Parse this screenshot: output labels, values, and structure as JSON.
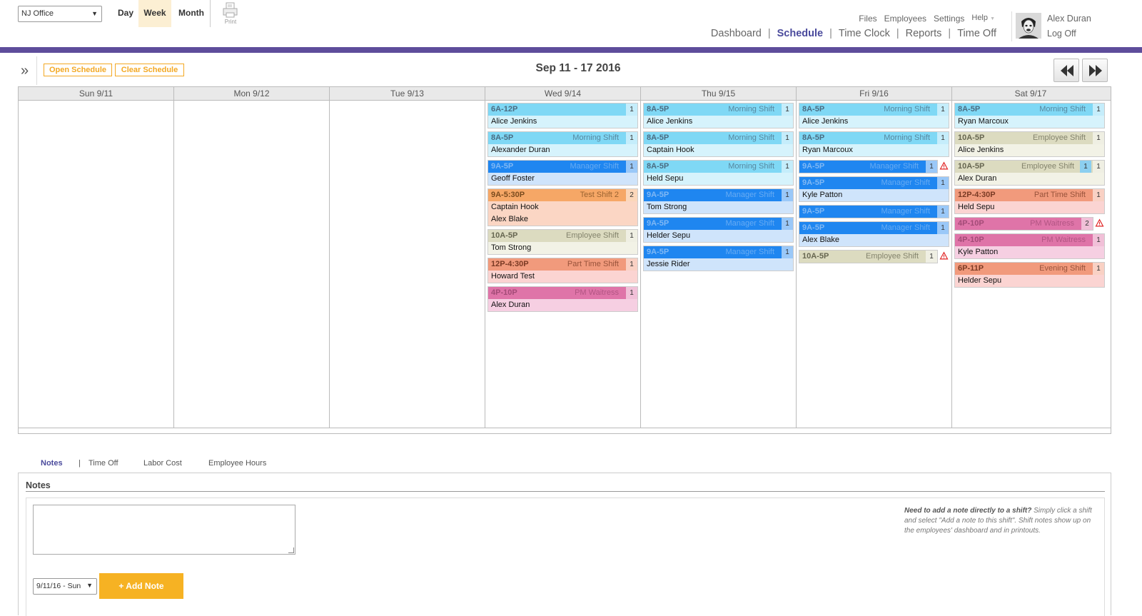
{
  "header": {
    "location": "NJ Office",
    "view_tabs": {
      "day": "Day",
      "week": "Week",
      "month": "Month"
    },
    "print_label": "Print",
    "top_links": {
      "files": "Files",
      "employees": "Employees",
      "settings": "Settings",
      "help": "Help"
    },
    "nav": {
      "dashboard": "Dashboard",
      "schedule": "Schedule",
      "time_clock": "Time Clock",
      "reports": "Reports",
      "time_off": "Time Off",
      "sep": "|"
    },
    "user": {
      "name": "Alex Duran",
      "logoff": "Log Off"
    }
  },
  "toolbar": {
    "open_schedule": "Open Schedule",
    "clear_schedule": "Clear Schedule",
    "week_range": "Sep 11 - 17 2016"
  },
  "calendar": {
    "days": [
      {
        "label": "Sun 9/11",
        "shifts": []
      },
      {
        "label": "Mon 9/12",
        "shifts": []
      },
      {
        "label": "Tue 9/13",
        "shifts": []
      },
      {
        "label": "Wed 9/14",
        "shifts": [
          {
            "time": "6A-12P",
            "type": "",
            "count": "1",
            "color": "cyan",
            "names": [
              "Alice Jenkins"
            ]
          },
          {
            "time": "8A-5P",
            "type": "Morning Shift",
            "count": "1",
            "color": "cyan",
            "names": [
              "Alexander Duran"
            ]
          },
          {
            "time": "9A-5P",
            "type": "Manager Shift",
            "count": "1",
            "color": "blue",
            "names": [
              "Geoff Foster"
            ]
          },
          {
            "time": "9A-5:30P",
            "type": "Test Shift 2",
            "count": "2",
            "color": "orange",
            "names": [
              "Captain Hook",
              "Alex Blake"
            ]
          },
          {
            "time": "10A-5P",
            "type": "Employee Shift",
            "count": "1",
            "color": "olive",
            "names": [
              "Tom Strong"
            ]
          },
          {
            "time": "12P-4:30P",
            "type": "Part Time Shift",
            "count": "1",
            "color": "salmon",
            "names": [
              "Howard Test"
            ]
          },
          {
            "time": "4P-10P",
            "type": "PM Waitress",
            "count": "1",
            "color": "pink",
            "names": [
              "Alex Duran"
            ]
          }
        ]
      },
      {
        "label": "Thu 9/15",
        "shifts": [
          {
            "time": "8A-5P",
            "type": "Morning Shift",
            "count": "1",
            "color": "cyan",
            "names": [
              "Alice Jenkins"
            ]
          },
          {
            "time": "8A-5P",
            "type": "Morning Shift",
            "count": "1",
            "color": "cyan",
            "names": [
              "Captain Hook"
            ]
          },
          {
            "time": "8A-5P",
            "type": "Morning Shift",
            "count": "1",
            "color": "cyan",
            "names": [
              "Held Sepu"
            ]
          },
          {
            "time": "9A-5P",
            "type": "Manager Shift",
            "count": "1",
            "color": "blue",
            "names": [
              "Tom Strong"
            ]
          },
          {
            "time": "9A-5P",
            "type": "Manager Shift",
            "count": "1",
            "color": "blue",
            "names": [
              "Helder Sepu"
            ]
          },
          {
            "time": "9A-5P",
            "type": "Manager Shift",
            "count": "1",
            "color": "blue",
            "names": [
              "Jessie Rider"
            ]
          }
        ]
      },
      {
        "label": "Fri 9/16",
        "shifts": [
          {
            "time": "8A-5P",
            "type": "Morning Shift",
            "count": "1",
            "color": "cyan",
            "names": [
              "Alice Jenkins"
            ]
          },
          {
            "time": "8A-5P",
            "type": "Morning Shift",
            "count": "1",
            "color": "cyan",
            "names": [
              "Ryan Marcoux"
            ]
          },
          {
            "time": "9A-5P",
            "type": "Manager Shift",
            "count": "1",
            "color": "blue",
            "names": [],
            "warn": true
          },
          {
            "time": "9A-5P",
            "type": "Manager Shift",
            "count": "1",
            "color": "blue",
            "names": [
              "Kyle Patton"
            ]
          },
          {
            "time": "9A-5P",
            "type": "Manager Shift",
            "count": "1",
            "color": "blue",
            "names": []
          },
          {
            "time": "9A-5P",
            "type": "Manager Shift",
            "count": "1",
            "color": "blue",
            "names": [
              "Alex Blake"
            ]
          },
          {
            "time": "10A-5P",
            "type": "Employee Shift",
            "count": "1",
            "color": "olive",
            "names": [],
            "warn": true
          }
        ]
      },
      {
        "label": "Sat 9/17",
        "shifts": [
          {
            "time": "8A-5P",
            "type": "Morning Shift",
            "count": "1",
            "color": "cyan",
            "names": [
              "Ryan Marcoux"
            ]
          },
          {
            "time": "10A-5P",
            "type": "Employee Shift",
            "count": "1",
            "color": "olive",
            "names": [
              "Alice Jenkins"
            ]
          },
          {
            "time": "10A-5P",
            "type": "Employee Shift",
            "count": "1",
            "color": "olive",
            "names": [
              "Alex Duran"
            ],
            "extra_count": "1"
          },
          {
            "time": "12P-4:30P",
            "type": "Part Time Shift",
            "count": "1",
            "color": "salmon",
            "names": [
              "Held Sepu"
            ]
          },
          {
            "time": "4P-10P",
            "type": "PM Waitress",
            "count": "2",
            "color": "pink",
            "names": [],
            "warn": true
          },
          {
            "time": "4P-10P",
            "type": "PM Waitress",
            "count": "1",
            "color": "pink",
            "names": [
              "Kyle Patton"
            ]
          },
          {
            "time": "6P-11P",
            "type": "Evening Shift",
            "count": "1",
            "color": "salmon",
            "names": [
              "Helder Sepu"
            ]
          }
        ]
      }
    ]
  },
  "bottom_tabs": {
    "notes": "Notes",
    "sep": "|",
    "time_off": "Time Off",
    "labor_cost": "Labor Cost",
    "employee_hours": "Employee Hours"
  },
  "notes": {
    "title": "Notes",
    "hint_bold": "Need to add a note directly to a shift?",
    "hint_rest": " Simply click a shift and select \"Add a note to this shift\". Shift notes show up on the employees' dashboard and in printouts.",
    "date_value": "9/11/16 - Sun",
    "add_note": "+ Add Note"
  },
  "colors": {
    "accent": "#5e4d9b",
    "orange_button": "#f6b223",
    "cyan_shift": "#7fd8f5",
    "blue_shift": "#1f86f0",
    "orange_shift": "#f6a766",
    "olive_shift": "#dcdbc0",
    "salmon_shift": "#f19a7c",
    "pink_shift": "#df74a8"
  }
}
